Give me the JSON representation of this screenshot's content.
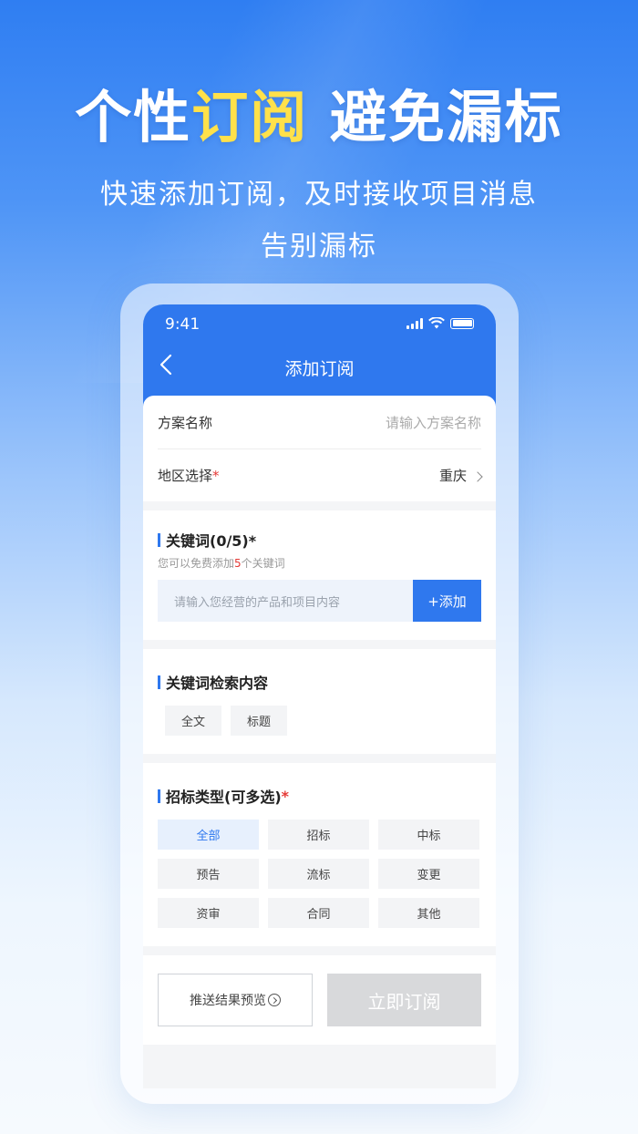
{
  "promo": {
    "headline_part1": "个性",
    "headline_highlight": "订阅",
    "headline_part2": " 避免漏标",
    "subtitle_line1": "快速添加订阅，及时接收项目消息",
    "subtitle_line2": "告别漏标"
  },
  "status_bar": {
    "time": "9:41"
  },
  "nav": {
    "title": "添加订阅",
    "back_icon": "chevron-left-icon"
  },
  "form": {
    "plan_name": {
      "label": "方案名称",
      "placeholder": "请输入方案名称"
    },
    "region": {
      "label": "地区选择",
      "required_mark": "*",
      "value": "重庆"
    }
  },
  "keywords": {
    "title": "关键词(0/5)*",
    "hint_prefix": "您可以免费添加",
    "hint_count": "5",
    "hint_suffix": "个关键词",
    "input_placeholder": "请输入您经营的产品和项目内容",
    "add_label": "+添加"
  },
  "search_scope": {
    "title": "关键词检索内容",
    "options": [
      "全文",
      "标题"
    ]
  },
  "bid_types": {
    "title": "招标类型(可多选)",
    "required_mark": "*",
    "options": [
      "全部",
      "招标",
      "中标",
      "预告",
      "流标",
      "变更",
      "资审",
      "合同",
      "其他"
    ],
    "selected": "全部"
  },
  "footer": {
    "preview_label": "推送结果预览",
    "subscribe_label": "立即订阅"
  },
  "colors": {
    "primary": "#2f78ee",
    "highlight": "#ffe14a",
    "required": "#e53935"
  }
}
